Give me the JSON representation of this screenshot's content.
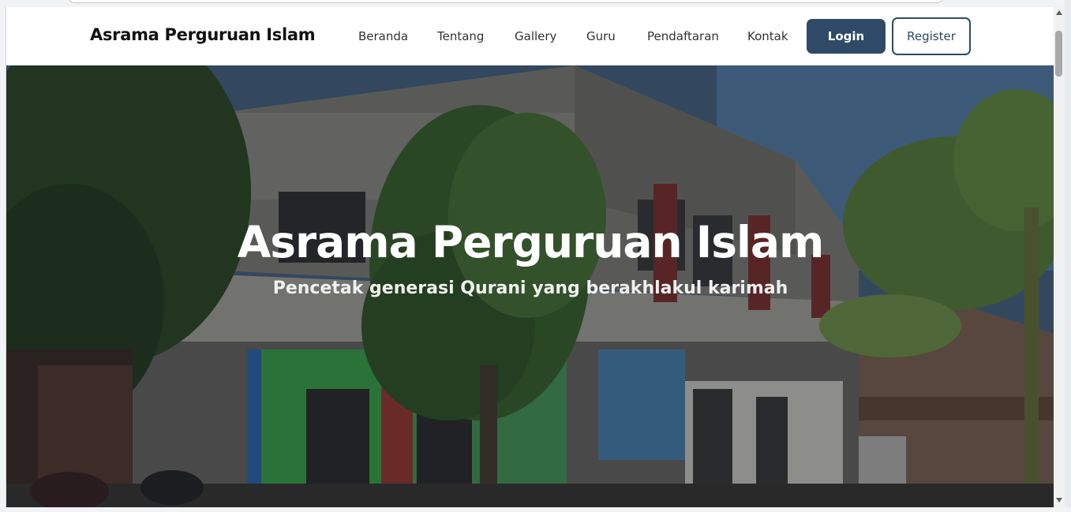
{
  "navbar": {
    "brand": "Asrama Perguruan Islam",
    "links": [
      "Beranda",
      "Tentang",
      "Gallery",
      "Guru",
      "Pendaftaran",
      "Kontak"
    ],
    "login_label": "Login",
    "register_label": "Register"
  },
  "hero": {
    "title": "Asrama Perguruan Islam",
    "subtitle": "Pencetak generasi Qurani yang berakhlakul karimah"
  },
  "colors": {
    "primary": "#2e4a66",
    "overlay": "rgba(20,24,32,0.42)"
  },
  "icons": {
    "scroll_up": "triangle-up-icon",
    "scroll_down": "triangle-down-icon"
  }
}
